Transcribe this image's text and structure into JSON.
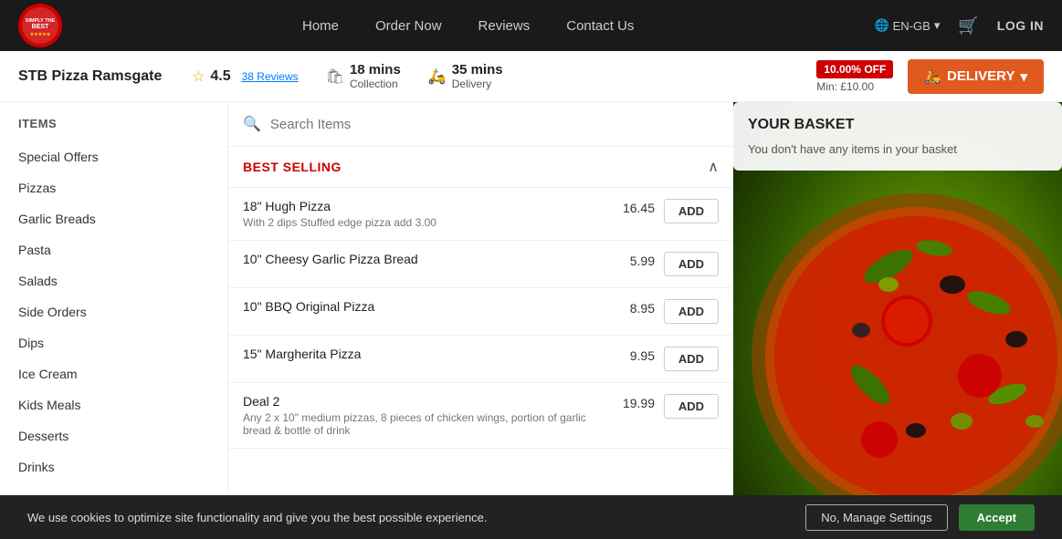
{
  "nav": {
    "logo_text": "SIMPLY THE BEST",
    "links": [
      "Home",
      "Order Now",
      "Reviews",
      "Contact Us"
    ],
    "lang": "EN-GB",
    "login": "LOG IN",
    "cart_icon": "🛒"
  },
  "restaurant": {
    "name": "STB Pizza Ramsgate",
    "rating": "4.5",
    "reviews": "38 Reviews",
    "collection_time": "18 mins",
    "collection_label": "Collection",
    "delivery_time": "35 mins",
    "delivery_label": "Delivery",
    "discount": "10.00% OFF",
    "min_order": "Min: £10.00",
    "delivery_btn": "DELIVERY"
  },
  "sidebar": {
    "title": "ITEMS",
    "items": [
      {
        "label": "Special Offers"
      },
      {
        "label": "Pizzas"
      },
      {
        "label": "Garlic Breads"
      },
      {
        "label": "Pasta"
      },
      {
        "label": "Salads"
      },
      {
        "label": "Side Orders"
      },
      {
        "label": "Dips"
      },
      {
        "label": "Ice Cream"
      },
      {
        "label": "Kids Meals"
      },
      {
        "label": "Desserts"
      },
      {
        "label": "Drinks"
      }
    ]
  },
  "search": {
    "placeholder": "Search Items"
  },
  "best_selling": {
    "section_title": "BEST SELLING",
    "items": [
      {
        "name": "18\" Hugh Pizza",
        "price": "16.45",
        "desc": "With 2 dips Stuffed edge pizza add 3.00",
        "add_label": "ADD"
      },
      {
        "name": "10\" Cheesy Garlic Pizza Bread",
        "price": "5.99",
        "desc": "",
        "add_label": "ADD"
      },
      {
        "name": "10\" BBQ Original Pizza",
        "price": "8.95",
        "desc": "",
        "add_label": "ADD"
      },
      {
        "name": "15\" Margherita Pizza",
        "price": "9.95",
        "desc": "",
        "add_label": "ADD"
      },
      {
        "name": "Deal 2",
        "price": "19.99",
        "desc": "Any 2 x 10\" medium pizzas, 8 pieces of chicken wings, portion of garlic bread & bottle of drink",
        "add_label": "ADD"
      }
    ]
  },
  "basket": {
    "title": "YOUR BASKET",
    "empty_text": "You don't have any items in your basket"
  },
  "cookie": {
    "text": "We use cookies to optimize site functionality and give you the best possible experience.",
    "manage_label": "No, Manage Settings",
    "accept_label": "Accept"
  }
}
